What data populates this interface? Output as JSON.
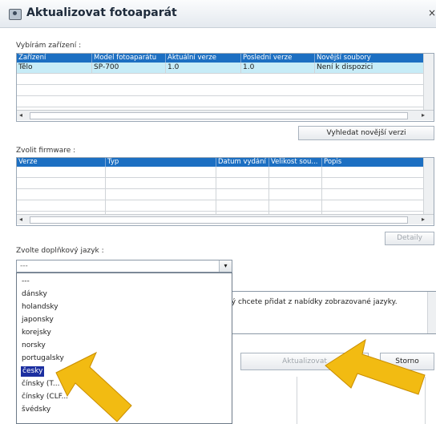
{
  "window": {
    "title": "Aktualizovat fotoaparát",
    "close_glyph": "×"
  },
  "device_section": {
    "label": "Vybírám zařízení :",
    "columns": [
      "Zařízení",
      "Model fotoaparátu",
      "Aktuální verze",
      "Poslední verze",
      "Novější soubory"
    ],
    "rows": [
      [
        "Tělo",
        "SP-700",
        "1.0",
        "1.0",
        "Není k dispozici"
      ]
    ]
  },
  "find_newer_button": "Vyhledat novější verzi",
  "firmware_section": {
    "label": "Zvolit firmware :",
    "columns": [
      "Verze",
      "Typ",
      "Datum vydání",
      "Velikost sou...",
      "Popis"
    ]
  },
  "details_button": "Detaily",
  "language_section": {
    "label": "Zvolte doplňkový jazyk :",
    "selected": "---",
    "options": [
      "---",
      "dánsky",
      "holandsky",
      "japonsky",
      "korejsky",
      "norsky",
      "portugalsky",
      "česky",
      "čínsky (T...",
      "čínsky (CLF...",
      "švédsky"
    ],
    "highlighted_index": 7
  },
  "description_text": "terý chcete přidat z nabídky zobrazované jazyky.",
  "update_button": "Aktualizovat",
  "cancel_button": "Storno",
  "colors": {
    "header_blue": "#1c6fc2",
    "selection_row": "#c7ecf7",
    "highlight": "#1c2fa0",
    "pointer": "#f2bb12"
  }
}
